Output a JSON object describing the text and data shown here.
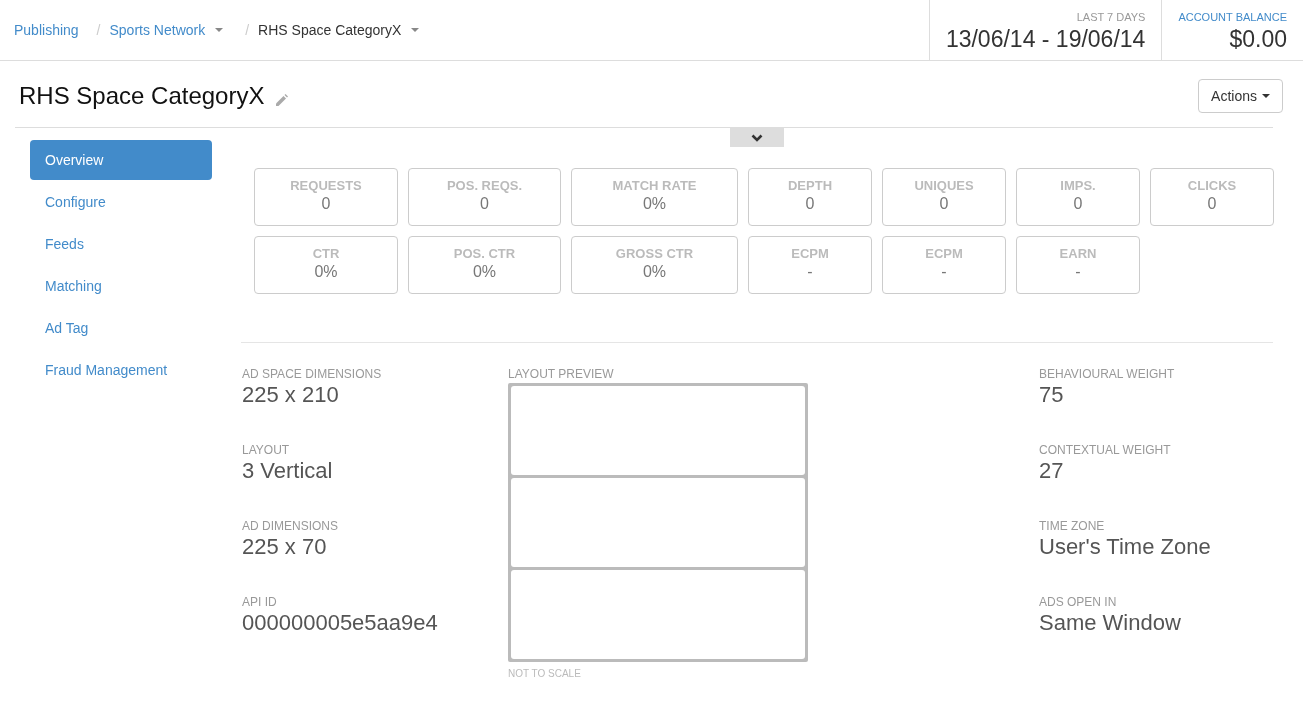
{
  "breadcrumbs": {
    "items": [
      {
        "label": "Publishing",
        "current": false,
        "dropdown": false
      },
      {
        "separator": "/",
        "label": "Sports Network",
        "current": false,
        "dropdown": true
      },
      {
        "separator": "/",
        "label": "RHS Space CategoryX",
        "current": true,
        "dropdown": true
      }
    ]
  },
  "header_stats": [
    {
      "label": "LAST 7 DAYS",
      "link": false,
      "value": "13/06/14 - 19/06/14"
    },
    {
      "label": "ACCOUNT BALANCE",
      "link": true,
      "value": "$0.00"
    }
  ],
  "page": {
    "title": "RHS Space CategoryX",
    "actions_button": "Actions"
  },
  "sidebar": {
    "items": [
      {
        "label": "Overview",
        "selected": true
      },
      {
        "label": "Configure",
        "selected": false
      },
      {
        "label": "Feeds",
        "selected": false
      },
      {
        "label": "Matching",
        "selected": false
      },
      {
        "label": "Ad Tag",
        "selected": false
      },
      {
        "label": "Fraud Management",
        "selected": false
      }
    ]
  },
  "stats": [
    {
      "label": "REQUESTS",
      "value": "0"
    },
    {
      "label": "POS. REQS.",
      "value": "0"
    },
    {
      "label": "MATCH RATE",
      "value": "0%"
    },
    {
      "label": "DEPTH",
      "value": "0"
    },
    {
      "label": "UNIQUES",
      "value": "0"
    },
    {
      "label": "IMPS.",
      "value": "0"
    },
    {
      "label": "CLICKS",
      "value": "0"
    },
    {
      "label": "CTR",
      "value": "0%"
    },
    {
      "label": "POS. CTR",
      "value": "0%"
    },
    {
      "label": "GROSS CTR",
      "value": "0%"
    },
    {
      "label": "ECPM",
      "value": "-"
    },
    {
      "label": "ECPM",
      "value": "-"
    },
    {
      "label": "EARN",
      "value": "-"
    }
  ],
  "details": {
    "left_fields": [
      {
        "label": "AD SPACE DIMENSIONS",
        "value": "225 x 210"
      },
      {
        "label": "LAYOUT",
        "value": "3 Vertical"
      },
      {
        "label": "AD DIMENSIONS",
        "value": "225 x 70"
      },
      {
        "label": "API ID",
        "value": "000000005e5aa9e4"
      }
    ],
    "preview": {
      "label": "LAYOUT PREVIEW",
      "note": "NOT TO SCALE"
    },
    "right_fields": [
      {
        "label": "BEHAVIOURAL WEIGHT",
        "value": "75"
      },
      {
        "label": "CONTEXTUAL WEIGHT",
        "value": "27"
      },
      {
        "label": "TIME ZONE",
        "value": "User's Time Zone"
      },
      {
        "label": "ADS OPEN IN",
        "value": "Same Window"
      }
    ]
  }
}
